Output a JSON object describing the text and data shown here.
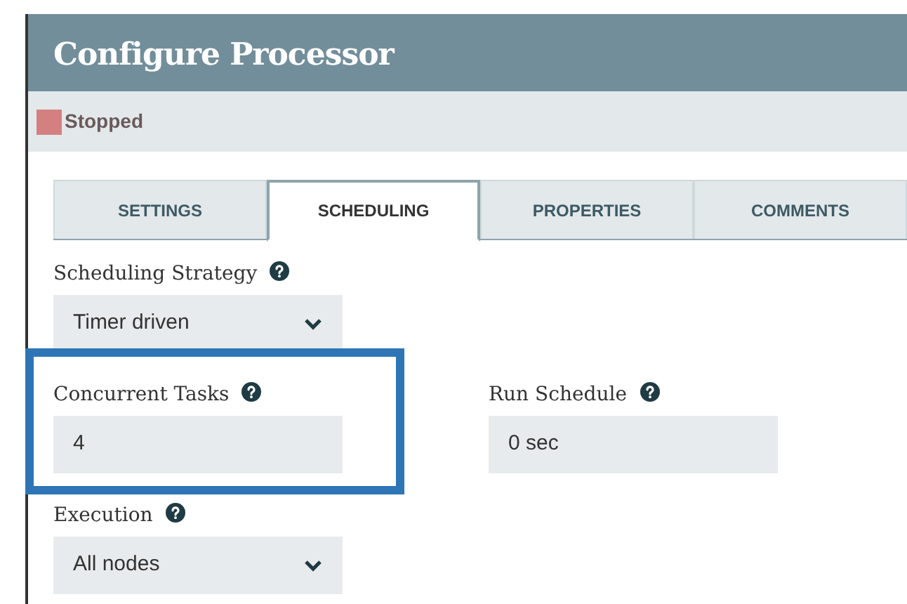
{
  "dialog": {
    "title": "Configure Processor"
  },
  "status": {
    "label": "Stopped",
    "color": "#d48080"
  },
  "tabs": [
    {
      "label": "SETTINGS",
      "selected": false
    },
    {
      "label": "SCHEDULING",
      "selected": true
    },
    {
      "label": "PROPERTIES",
      "selected": false
    },
    {
      "label": "COMMENTS",
      "selected": false
    }
  ],
  "rows": [
    [
      {
        "label": "Scheduling Strategy",
        "kind": "select",
        "value": "Timer driven",
        "highlighted": false
      }
    ],
    [
      {
        "label": "Concurrent Tasks",
        "kind": "input",
        "value": "4",
        "highlighted": true
      },
      {
        "label": "Run Schedule",
        "kind": "input",
        "value": "0 sec",
        "highlighted": false
      }
    ],
    [
      {
        "label": "Execution",
        "kind": "select",
        "value": "All nodes",
        "highlighted": false
      }
    ]
  ]
}
